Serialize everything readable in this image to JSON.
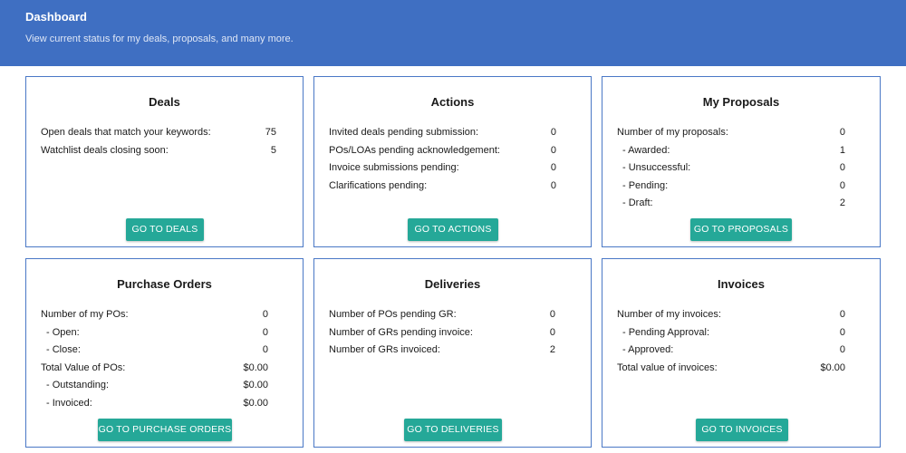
{
  "header": {
    "title": "Dashboard",
    "subtitle": "View current status for my deals, proposals, and many more."
  },
  "colors": {
    "header_bg": "#3f6fc2",
    "card_border": "#4a78c6",
    "button_bg": "#25a898"
  },
  "cards": {
    "deals": {
      "title": "Deals",
      "rows": [
        {
          "label": "Open deals that match your keywords:",
          "value": "75"
        },
        {
          "label": "Watchlist deals closing soon:",
          "value": "5"
        }
      ],
      "button": "GO TO DEALS"
    },
    "actions": {
      "title": "Actions",
      "rows": [
        {
          "label": "Invited deals pending submission:",
          "value": "0"
        },
        {
          "label": "POs/LOAs pending acknowledgement:",
          "value": "0"
        },
        {
          "label": "Invoice submissions pending:",
          "value": "0"
        },
        {
          "label": "Clarifications pending:",
          "value": "0"
        }
      ],
      "button": "GO TO ACTIONS"
    },
    "proposals": {
      "title": "My Proposals",
      "rows": [
        {
          "label": "Number of my proposals:",
          "value": "0"
        },
        {
          "label": "- Awarded:",
          "value": "1"
        },
        {
          "label": "- Unsuccessful:",
          "value": "0"
        },
        {
          "label": "- Pending:",
          "value": "0"
        },
        {
          "label": "- Draft:",
          "value": "2"
        }
      ],
      "button": "GO TO PROPOSALS"
    },
    "purchase_orders": {
      "title": "Purchase Orders",
      "rows": [
        {
          "label": "Number of my POs:",
          "value": "0"
        },
        {
          "label": "- Open:",
          "value": "0"
        },
        {
          "label": "- Close:",
          "value": "0"
        },
        {
          "label": "Total Value of POs:",
          "value": "$0.00"
        },
        {
          "label": "- Outstanding:",
          "value": "$0.00"
        },
        {
          "label": "- Invoiced:",
          "value": "$0.00"
        }
      ],
      "button": "GO TO PURCHASE ORDERS"
    },
    "deliveries": {
      "title": "Deliveries",
      "rows": [
        {
          "label": "Number of POs pending GR:",
          "value": "0"
        },
        {
          "label": "Number of GRs pending invoice:",
          "value": "0"
        },
        {
          "label": "Number of GRs invoiced:",
          "value": "2"
        }
      ],
      "button": "GO TO DELIVERIES"
    },
    "invoices": {
      "title": "Invoices",
      "rows": [
        {
          "label": "Number of my invoices:",
          "value": "0"
        },
        {
          "label": "- Pending Approval:",
          "value": "0"
        },
        {
          "label": "- Approved:",
          "value": "0"
        },
        {
          "label": "Total value of invoices:",
          "value": "$0.00"
        }
      ],
      "button": "GO TO INVOICES"
    }
  }
}
